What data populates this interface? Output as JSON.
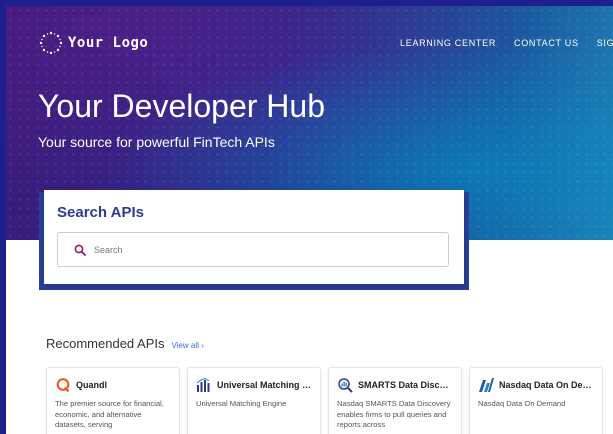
{
  "header": {
    "logo_text": "Your Logo",
    "nav": [
      "LEARNING CENTER",
      "CONTACT US",
      "SIGN UP"
    ]
  },
  "hero": {
    "title": "Your Developer Hub",
    "subtitle": "Your source for powerful FinTech APIs"
  },
  "search": {
    "title": "Search APIs",
    "placeholder": "Search"
  },
  "recommended": {
    "title": "Recommended APIs",
    "view_all": "View all ›",
    "cards": [
      {
        "name": "Quandl",
        "icon": "quandl-logo-icon",
        "description": "The premier source for financial, economic, and alternative datasets, serving"
      },
      {
        "name": "Universal Matching E…",
        "icon": "bar-chart-icon",
        "description": "Universal Matching Engine"
      },
      {
        "name": "SMARTS Data Discov…",
        "icon": "magnifier-chart-icon",
        "description": "Nasdaq SMARTS Data Discovery enables firms to pull queries and reports across"
      },
      {
        "name": "Nasdaq Data On Dem…",
        "icon": "nasdaq-logo-icon",
        "description": "Nasdaq Data On Demand"
      }
    ]
  },
  "colors": {
    "page_border": "#1c1f8c",
    "hero_start": "#3a1a78",
    "hero_end": "#1f80b6",
    "search_title": "#2d3c90",
    "accent_magenta": "#8e1b6e",
    "link_blue": "#3a6fd0",
    "quandl_orange": "#e8601c",
    "nasdaq_blue": "#1f5fa8"
  }
}
